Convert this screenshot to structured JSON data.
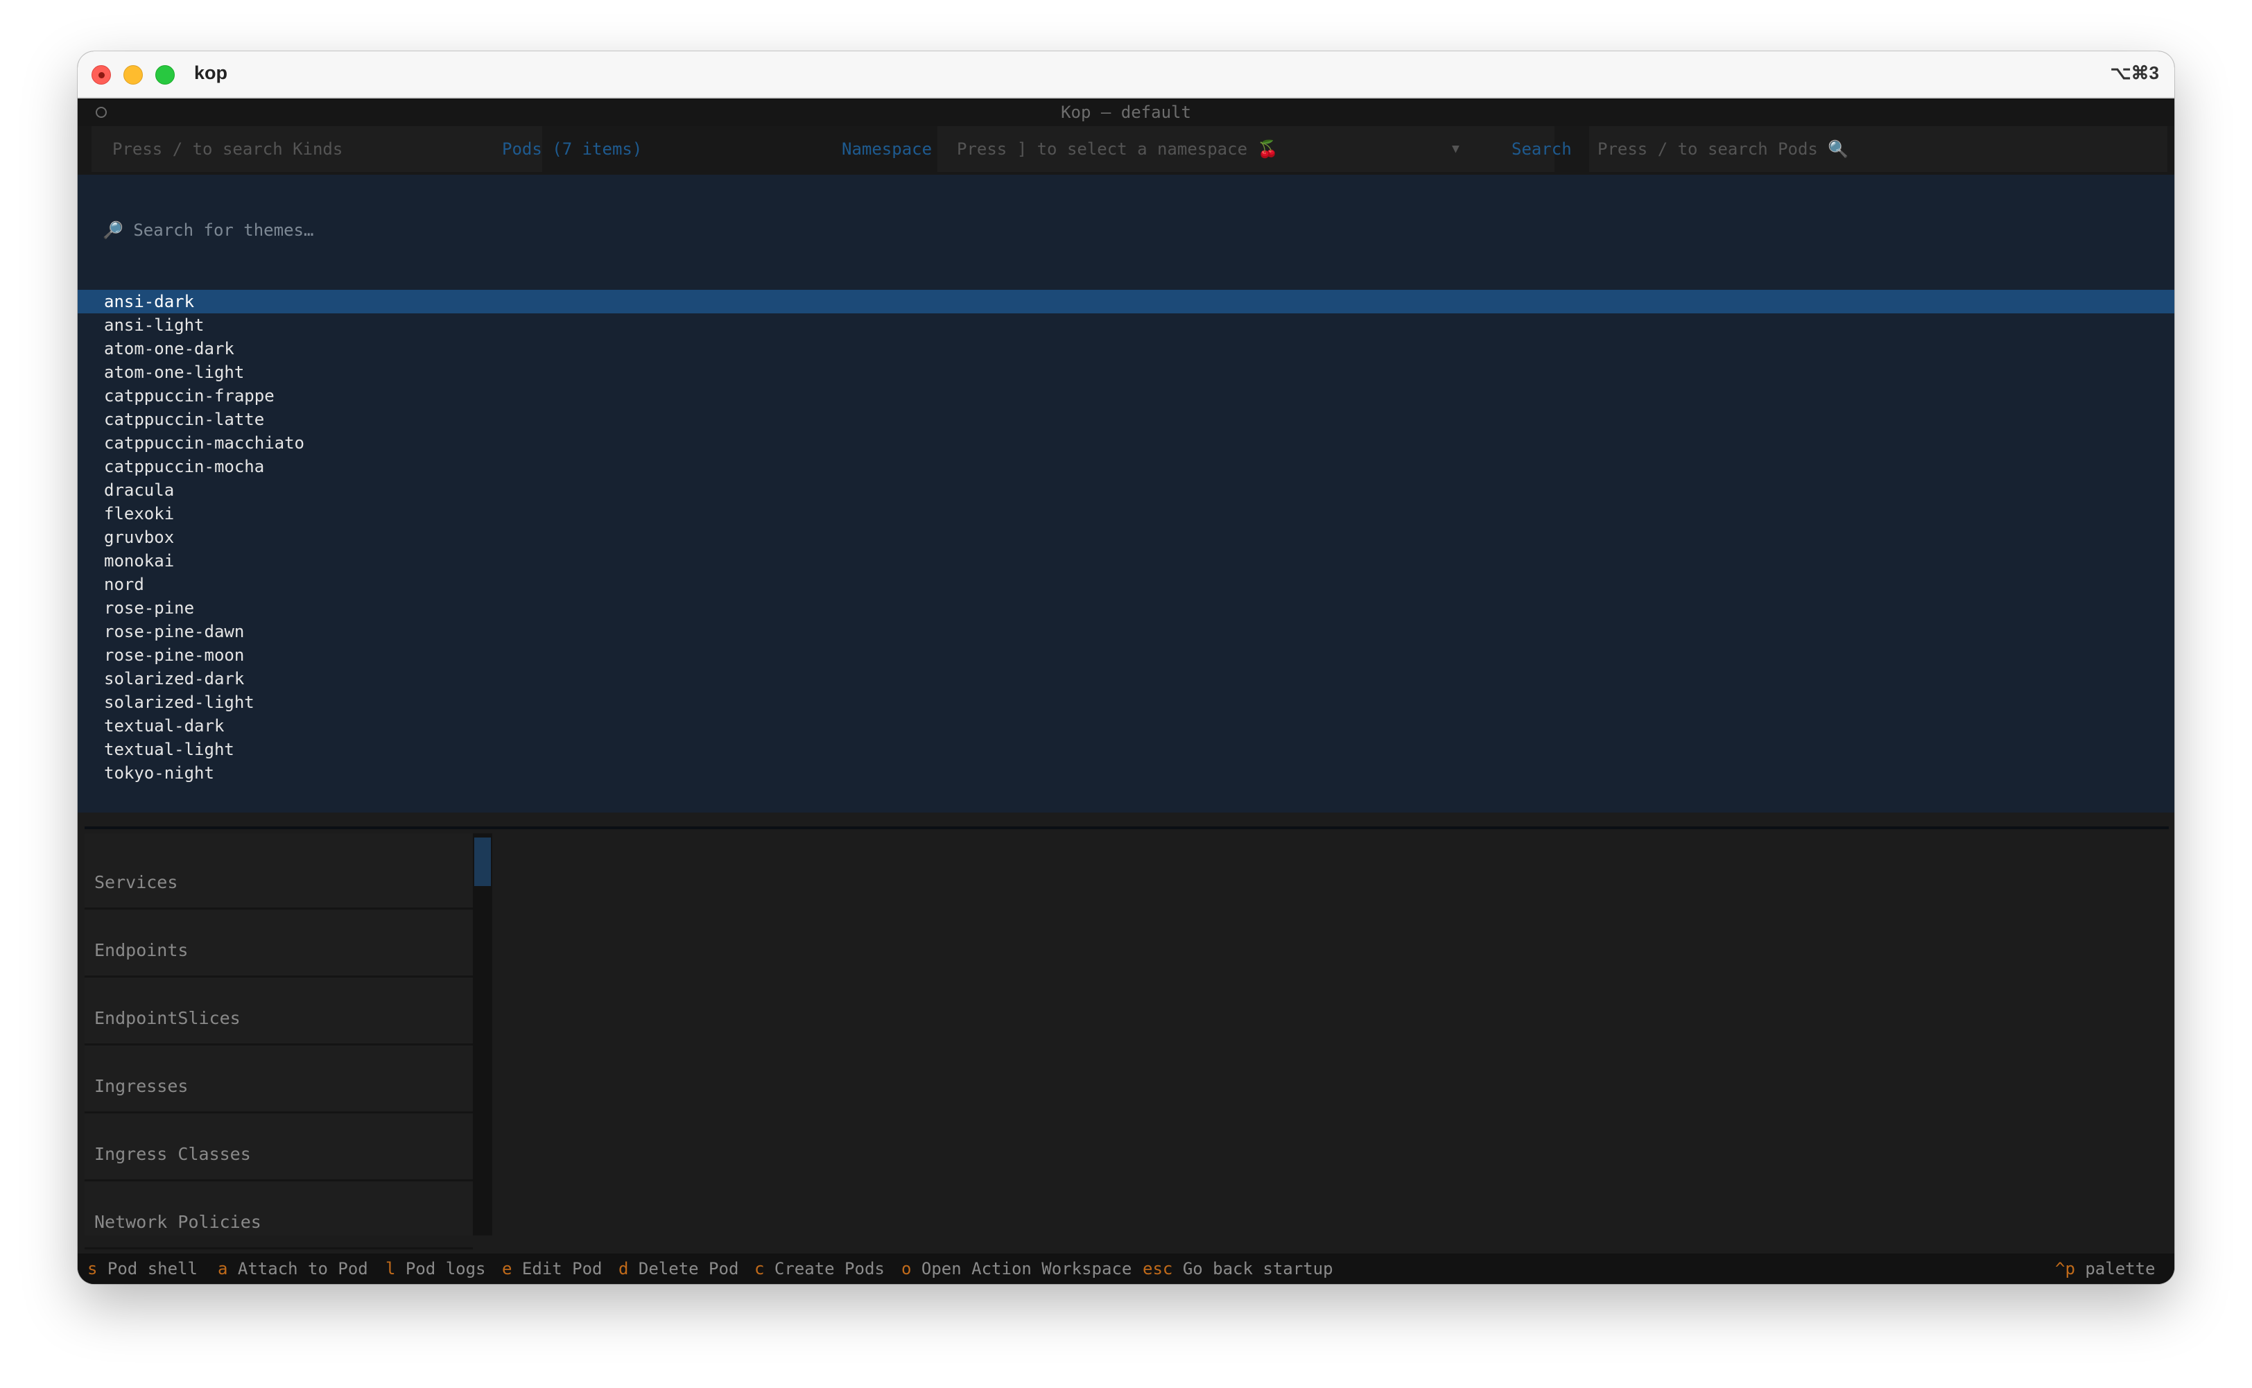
{
  "window": {
    "title": "kop",
    "shortcut": "⌥⌘3"
  },
  "app": {
    "title": "Kop – default"
  },
  "topbar": {
    "kinds_search_placeholder": "Press / to search Kinds",
    "pods_label": "Pods (7 items)",
    "namespace_label": "Namespace",
    "namespace_placeholder": "Press ] to select a namespace 🍒",
    "namespace_dropdown_icon": "▼",
    "search_label": "Search",
    "pods_search_placeholder": "Press / to search Pods 🔍"
  },
  "theme_picker": {
    "search_icon": "🔎",
    "search_placeholder": "Search for themes…",
    "selected_index": 0,
    "themes": [
      "ansi-dark",
      "ansi-light",
      "atom-one-dark",
      "atom-one-light",
      "catppuccin-frappe",
      "catppuccin-latte",
      "catppuccin-macchiato",
      "catppuccin-mocha",
      "dracula",
      "flexoki",
      "gruvbox",
      "monokai",
      "nord",
      "rose-pine",
      "rose-pine-dawn",
      "rose-pine-moon",
      "solarized-dark",
      "solarized-light",
      "textual-dark",
      "textual-light",
      "tokyo-night"
    ]
  },
  "sidebar": {
    "items": [
      {
        "label": "Services"
      },
      {
        "label": "Endpoints"
      },
      {
        "label": "EndpointSlices"
      },
      {
        "label": "Ingresses"
      },
      {
        "label": "Ingress Classes"
      },
      {
        "label": "Network Policies"
      }
    ]
  },
  "footer": {
    "bindings": [
      {
        "key": "s",
        "label": "Pod shell"
      },
      {
        "key": "a",
        "label": "Attach to Pod"
      },
      {
        "key": "l",
        "label": "Pod logs"
      },
      {
        "key": "e",
        "label": "Edit Pod"
      },
      {
        "key": "d",
        "label": "Delete Pod"
      },
      {
        "key": "c",
        "label": "Create Pods"
      },
      {
        "key": "o",
        "label": "Open Action Workspace"
      },
      {
        "key": "esc",
        "label": "Go back startup"
      }
    ],
    "palette_key": "^p",
    "palette_label": "palette"
  },
  "colors": {
    "selected_row": "#1c4a78",
    "overlay_bg": "#172231",
    "accent": "#1e5a8f",
    "key_hint": "#c06a1a"
  }
}
